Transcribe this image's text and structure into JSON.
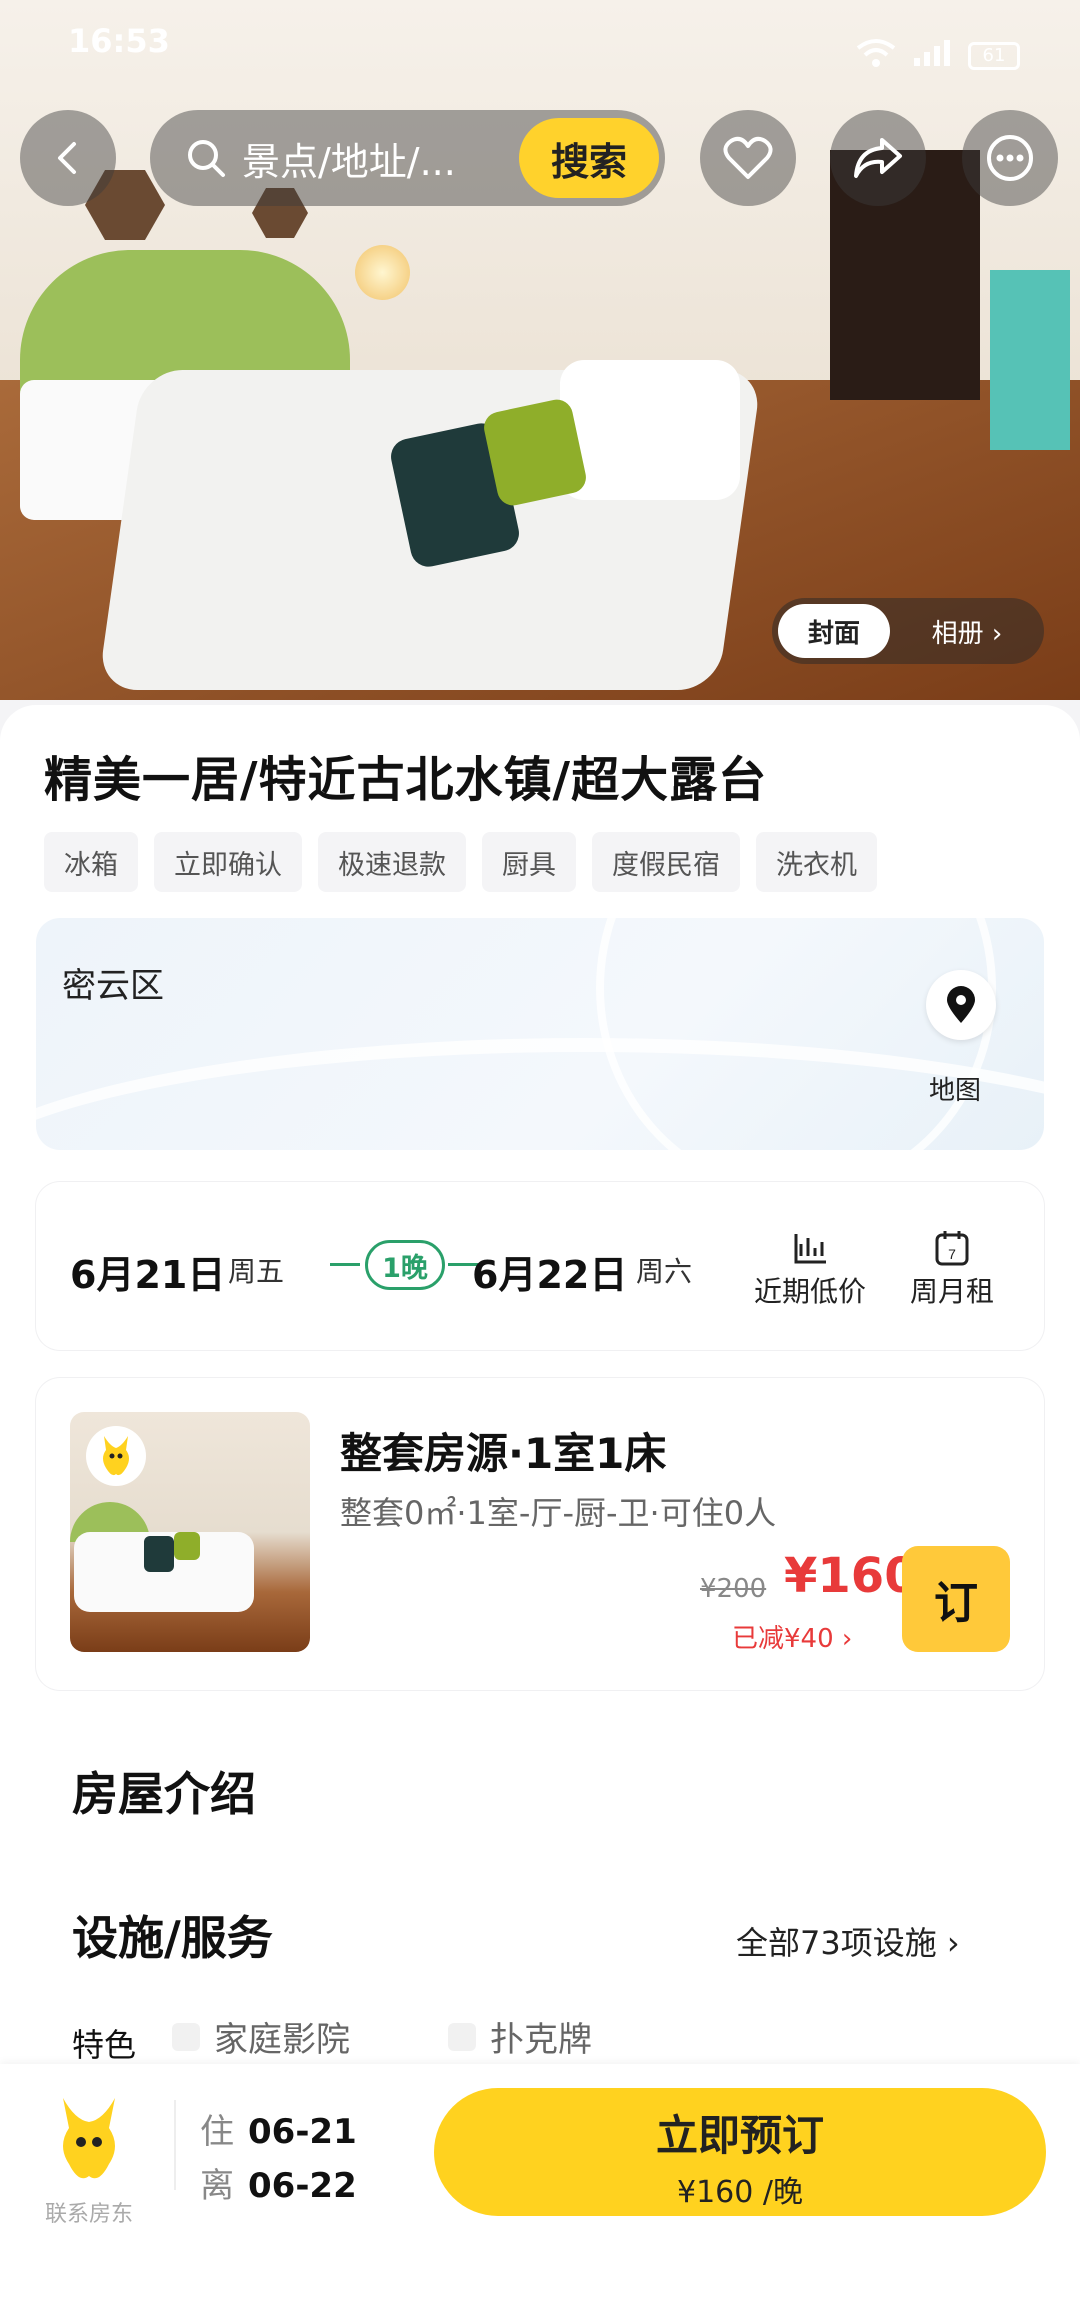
{
  "status": {
    "time": "16:53",
    "battery": "61"
  },
  "search": {
    "placeholder": "景点/地址/...",
    "button": "搜索"
  },
  "cover": {
    "cover_label": "封面",
    "album_label": "相册 ›"
  },
  "listing": {
    "title": "精美一居/特近古北水镇/超大露台",
    "tags": [
      "冰箱",
      "立即确认",
      "极速退款",
      "厨具",
      "度假民宿",
      "洗衣机"
    ]
  },
  "map": {
    "district": "密云区",
    "label": "地图"
  },
  "dates": {
    "checkin": "6月21日",
    "checkin_day": "周五",
    "nights": "1晚",
    "checkout": "6月22日",
    "checkout_day": "周六",
    "low_price": "近期低价",
    "monthly": "周月租"
  },
  "room": {
    "title": "整套房源·1室1床",
    "subtitle": "整套0㎡·1室-厅-厨-卫·可住0人",
    "old_price": "¥200",
    "price": "¥160",
    "discount": "已减¥40 ›",
    "book": "订"
  },
  "intro": {
    "title": "房屋介绍",
    "facilities_title": "设施/服务",
    "all_facilities": "全部73项设施 ›",
    "special_label": "特色",
    "features": [
      "家庭影院",
      "扑克牌"
    ]
  },
  "bottom": {
    "contact": "联系房东",
    "checkin_key": "住",
    "checkin": "06-21",
    "checkout_key": "离",
    "checkout": "06-22",
    "book_now": "立即预订",
    "price_per_night": "¥160 /晚"
  },
  "colors": {
    "accent": "#ffd21f",
    "price": "#e83a3a",
    "green": "#2aa06a"
  }
}
